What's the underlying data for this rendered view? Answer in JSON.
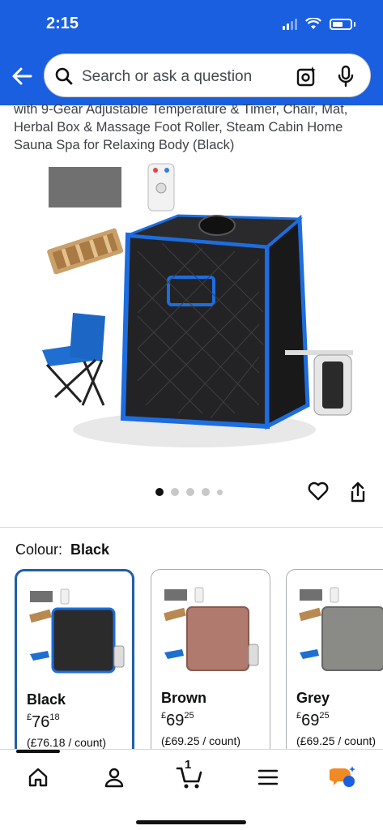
{
  "status_bar": {
    "time": "2:15"
  },
  "search": {
    "placeholder": "Search or ask a question"
  },
  "product": {
    "title": "with 9-Gear Adjustable Temperature & Timer, Chair, Mat, Herbal Box & Massage Foot Roller, Steam Cabin Home Sauna Spa for Relaxing Body (Black)",
    "image_count": 5,
    "active_image": 1
  },
  "colour": {
    "label": "Colour:",
    "selected": "Black",
    "options": [
      {
        "name": "Black",
        "price_whole": "76",
        "price_fraction": "18",
        "currency": "£",
        "unit_price": "(£76.18 / count)",
        "tent_color": "#2b2b2b",
        "selected": true
      },
      {
        "name": "Brown",
        "price_whole": "69",
        "price_fraction": "25",
        "currency": "£",
        "unit_price": "(£69.25 / count)",
        "tent_color": "#b07a6e",
        "selected": false
      },
      {
        "name": "Grey",
        "price_whole": "69",
        "price_fraction": "25",
        "currency": "£",
        "unit_price": "(£69.25 / count)",
        "tent_color": "#8a8a86",
        "selected": false
      }
    ]
  },
  "bottom_nav": {
    "items": [
      "home-icon",
      "account-icon",
      "cart-icon",
      "menu-icon",
      "rufus-icon"
    ],
    "cart_count": "1"
  },
  "colors": {
    "header_blue": "#1a5fe0",
    "selected_border": "#1f5fa8",
    "accent_orange": "#f08a24"
  }
}
